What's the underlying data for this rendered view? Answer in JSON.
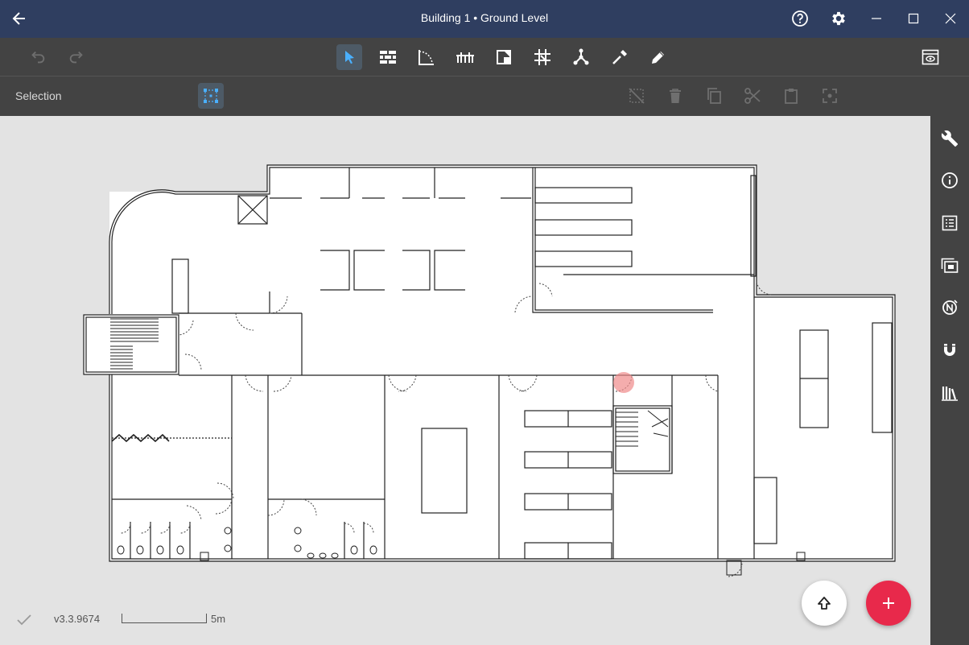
{
  "titlebar": {
    "title": "Building 1 • Ground Level",
    "icons": [
      "back-arrow-icon",
      "help-icon",
      "gear-icon",
      "minimize-icon",
      "maximize-icon",
      "close-icon"
    ]
  },
  "toolbar": {
    "left_tools": [
      "undo-icon",
      "redo-icon"
    ],
    "center_tools": [
      "select-pointer-icon",
      "wall-icon",
      "room-shape-icon",
      "furniture-icon",
      "area-icon",
      "grid-snap-icon",
      "node-icon",
      "measure-icon",
      "pencil-icon"
    ],
    "active_tool": "select-pointer-icon",
    "right_tools": [
      "view-mode-icon"
    ]
  },
  "subbar": {
    "label": "Selection",
    "tools": [
      "selection-box-icon",
      "deselect-icon",
      "delete-icon",
      "copy-icon",
      "cut-icon",
      "paste-icon",
      "focus-icon"
    ]
  },
  "sidebar": {
    "icons": [
      "wrench-icon",
      "info-icon",
      "list-icon",
      "layers-icon",
      "compass-icon",
      "magnet-icon",
      "library-icon"
    ]
  },
  "status": {
    "version": "v3.3.9674",
    "scale_label": "5m"
  },
  "colors": {
    "titlebar": "#2f3e60",
    "toolbar": "#434343",
    "canvas": "#e3e3e3",
    "accent": "#e8294b",
    "active_tool_bg": "#4d5a66",
    "selection_accent": "#4ab0ff"
  }
}
